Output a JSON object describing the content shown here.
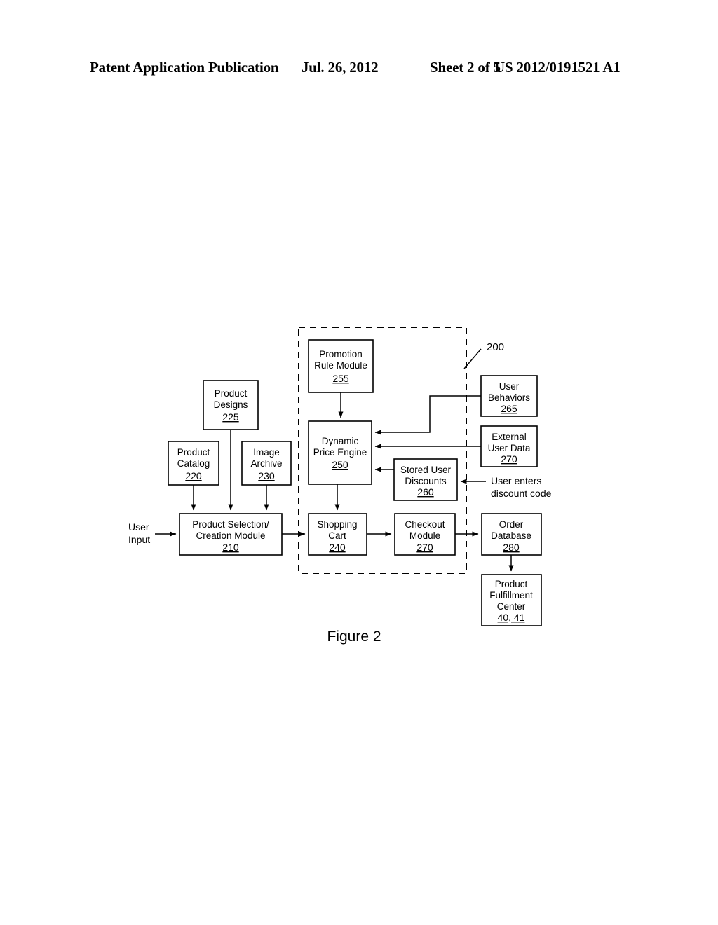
{
  "header": {
    "publication": "Patent Application Publication",
    "date": "Jul. 26, 2012",
    "sheet": "Sheet 2 of 5",
    "patent_number": "US 2012/0191521 A1"
  },
  "figure": {
    "caption": "Figure 2",
    "system_reference": "200"
  },
  "nodes": {
    "promotion_rule_module": {
      "line1": "Promotion",
      "line2": "Rule Module",
      "ref": "255"
    },
    "product_designs": {
      "line1": "Product",
      "line2": "Designs",
      "ref": "225"
    },
    "product_catalog": {
      "line1": "Product",
      "line2": "Catalog",
      "ref": "220"
    },
    "image_archive": {
      "line1": "Image",
      "line2": "Archive",
      "ref": "230"
    },
    "dynamic_price_engine": {
      "line1": "Dynamic",
      "line2": "Price Engine",
      "ref": "250"
    },
    "stored_user_discounts": {
      "line1": "Stored User",
      "line2": "Discounts",
      "ref": "260"
    },
    "user_behaviors": {
      "line1": "User",
      "line2": "Behaviors",
      "ref": "265"
    },
    "external_user_data": {
      "line1": "External",
      "line2": "User Data",
      "ref": "270"
    },
    "product_selection_creation_module": {
      "line1": "Product Selection/",
      "line2": "Creation Module",
      "ref": "210"
    },
    "shopping_cart": {
      "line1": "Shopping",
      "line2": "Cart",
      "ref": "240"
    },
    "checkout_module": {
      "line1": "Checkout",
      "line2": "Module",
      "ref": "270"
    },
    "order_database": {
      "line1": "Order",
      "line2": "Database",
      "ref": "280"
    },
    "product_fulfillment_center": {
      "line1": "Product",
      "line2": "Fulfillment",
      "line3": "Center",
      "ref": "40, 41"
    }
  },
  "annotations": {
    "user_input": {
      "line1": "User",
      "line2": "Input"
    },
    "discount_code": {
      "line1": "User enters",
      "line2": "discount code"
    }
  }
}
